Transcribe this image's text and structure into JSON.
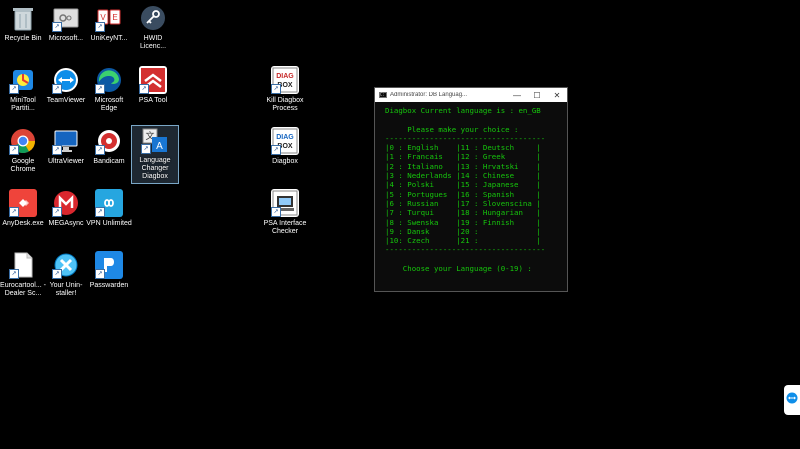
{
  "desktop": {
    "icons": [
      {
        "label": "Recycle Bin",
        "icon": "recycle-bin-icon"
      },
      {
        "label": "Microsoft...",
        "icon": "microsoft-app-icon"
      },
      {
        "label": "UniKeyNT...",
        "icon": "unikey-icon"
      },
      {
        "label": "HWID Licenc...",
        "icon": "hwid-key-icon"
      },
      {
        "label": "MiniTool Partiti...",
        "icon": "minitool-icon"
      },
      {
        "label": "TeamViewer",
        "icon": "teamviewer-icon"
      },
      {
        "label": "Microsoft Edge",
        "icon": "edge-icon"
      },
      {
        "label": "PSA Tool",
        "icon": "psa-tool-icon"
      },
      {
        "label": "Kill Diagbox Process",
        "icon": "kill-diagbox-icon"
      },
      {
        "label": "Google Chrome",
        "icon": "chrome-icon"
      },
      {
        "label": "UltraViewer",
        "icon": "ultraviewer-icon"
      },
      {
        "label": "Bandicam",
        "icon": "bandicam-icon"
      },
      {
        "label": "Language Changer Diagbox",
        "icon": "language-changer-icon"
      },
      {
        "label": "Diagbox",
        "icon": "diagbox-icon"
      },
      {
        "label": "AnyDesk.exe",
        "icon": "anydesk-icon"
      },
      {
        "label": "MEGAsync",
        "icon": "megasync-icon"
      },
      {
        "label": "VPN Unlimited",
        "icon": "vpn-unlimited-icon"
      },
      {
        "label": "PSA Interface Checker",
        "icon": "psa-interface-checker-icon"
      },
      {
        "label": "Eurocartool... - Dealer Sc...",
        "icon": "document-icon"
      },
      {
        "label": "Your Unin-staller!",
        "icon": "uninstaller-icon"
      },
      {
        "label": "Passwarden",
        "icon": "passwarden-icon"
      }
    ]
  },
  "console": {
    "title": "Administrator: DB Languag...",
    "lines": [
      "Diagbox Current language is : en_GB",
      "",
      "     Please make your choice :",
      "------------------------------------",
      "|0 : English    |11 : Deutsch     |",
      "|1 : Francais   |12 : Greek       |",
      "|2 : Italiano   |13 : Hrvatski    |",
      "|3 : Nederlands |14 : Chinese     |",
      "|4 : Polski     |15 : Japanese    |",
      "|5 : Portugues  |16 : Spanish     |",
      "|6 : Russian    |17 : Slovenscina |",
      "|7 : Turqui     |18 : Hungarian   |",
      "|8 : Swenska    |19 : Finnish     |",
      "|9 : Dansk      |20 :             |",
      "|10: Czech      |21 :             |",
      "------------------------------------",
      "",
      "    Choose your Language (0-19) :"
    ]
  },
  "teamviewer_tab": {
    "icon": "teamviewer-tab-icon"
  }
}
